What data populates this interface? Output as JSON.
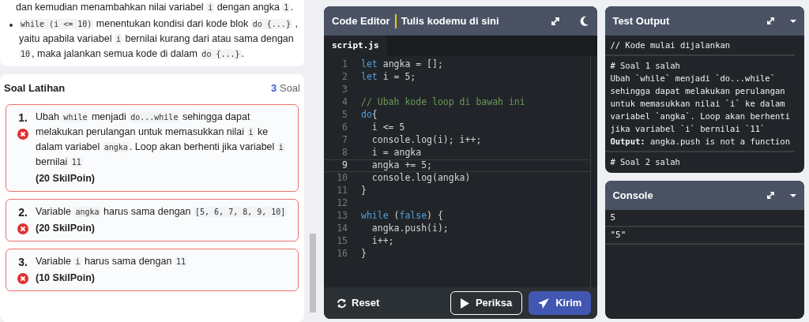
{
  "lesson": {
    "paragraphs": [
      {
        "kind": "paragraph",
        "segments": [
          {
            "kind": "text",
            "text": "dan kemudian menambahkan nilai variabel "
          },
          {
            "kind": "code",
            "text": "i"
          },
          {
            "kind": "text",
            "text": " dengan angka "
          },
          {
            "kind": "code",
            "text": "1"
          },
          {
            "kind": "text",
            "text": "."
          }
        ]
      },
      {
        "kind": "bullet",
        "segments": [
          {
            "kind": "code",
            "text": "while (i <= 10)"
          },
          {
            "kind": "text",
            "text": " menentukan kondisi dari kode blok "
          },
          {
            "kind": "code",
            "text": "do {...}"
          },
          {
            "kind": "text",
            "text": " , yaitu apabila variabel "
          },
          {
            "kind": "code",
            "text": "i"
          },
          {
            "kind": "text",
            "text": " bernilai kurang dari atau sama dengan "
          },
          {
            "kind": "code",
            "text": "10"
          },
          {
            "kind": "text",
            "text": ", maka jalankan semua kode di dalam "
          },
          {
            "kind": "code",
            "text": "do {...}"
          },
          {
            "kind": "text",
            "text": "."
          }
        ]
      }
    ]
  },
  "exercises": {
    "title": "Soal Latihan",
    "count": "3",
    "count_label": "Soal",
    "items": [
      {
        "number": "1.",
        "passed": false,
        "points": "(20 SkilPoin)",
        "segments": [
          {
            "kind": "text",
            "text": "Ubah "
          },
          {
            "kind": "code",
            "text": "while"
          },
          {
            "kind": "text",
            "text": " menjadi "
          },
          {
            "kind": "code",
            "text": "do...while"
          },
          {
            "kind": "text",
            "text": " sehingga dapat melakukan perulangan untuk memasukkan nilai "
          },
          {
            "kind": "code",
            "text": "i"
          },
          {
            "kind": "text",
            "text": " ke dalam variabel "
          },
          {
            "kind": "code",
            "text": "angka"
          },
          {
            "kind": "text",
            "text": ". Loop akan berhenti jika variabel "
          },
          {
            "kind": "code",
            "text": "i"
          },
          {
            "kind": "text",
            "text": " bernilai "
          },
          {
            "kind": "code",
            "text": "11"
          }
        ]
      },
      {
        "number": "2.",
        "passed": false,
        "points": "(20 SkilPoin)",
        "segments": [
          {
            "kind": "text",
            "text": "Variable "
          },
          {
            "kind": "code",
            "text": "angka"
          },
          {
            "kind": "text",
            "text": " harus sama dengan "
          },
          {
            "kind": "code",
            "text": "[5, 6, 7, 8, 9, 10]"
          }
        ]
      },
      {
        "number": "3.",
        "passed": false,
        "points": "(10 SkilPoin)",
        "segments": [
          {
            "kind": "text",
            "text": "Variable "
          },
          {
            "kind": "code",
            "text": "i"
          },
          {
            "kind": "text",
            "text": " harus sama dengan "
          },
          {
            "kind": "code",
            "text": "11"
          }
        ]
      }
    ]
  },
  "editor": {
    "title": "Code Editor",
    "subtitle": "Tulis kodemu di sini",
    "tabs": [
      {
        "label": "script.js",
        "selected": true
      }
    ],
    "lines": [
      {
        "number": "1",
        "selected": false,
        "tokens": [
          {
            "kind": "keyword",
            "text": "let"
          },
          {
            "kind": "plain",
            "text": " angka = [];"
          }
        ]
      },
      {
        "number": "2",
        "selected": false,
        "tokens": [
          {
            "kind": "keyword",
            "text": "let"
          },
          {
            "kind": "plain",
            "text": " i = 5;"
          }
        ]
      },
      {
        "number": "3",
        "selected": false
      },
      {
        "number": "4",
        "selected": false,
        "tokens": [
          {
            "kind": "comment",
            "text": "// Ubah kode loop di bawah ini"
          }
        ]
      },
      {
        "number": "5",
        "selected": false,
        "tokens": [
          {
            "kind": "keyword",
            "text": "do"
          },
          {
            "kind": "plain",
            "text": "{"
          }
        ]
      },
      {
        "number": "6",
        "selected": false,
        "tokens": [
          {
            "kind": "plain",
            "text": "  i <= 5"
          }
        ]
      },
      {
        "number": "7",
        "selected": false,
        "tokens": [
          {
            "kind": "plain",
            "text": "  console.log(i); i++;"
          }
        ]
      },
      {
        "number": "8",
        "selected": false,
        "tokens": [
          {
            "kind": "plain",
            "text": "  i = angka"
          }
        ]
      },
      {
        "number": "9",
        "selected": true,
        "tokens": [
          {
            "kind": "plain",
            "text": "  angka += 5;"
          }
        ]
      },
      {
        "number": "10",
        "selected": false,
        "tokens": [
          {
            "kind": "plain",
            "text": "  console.log(angka)"
          }
        ]
      },
      {
        "number": "11",
        "selected": false,
        "tokens": [
          {
            "kind": "plain",
            "text": "}"
          }
        ]
      },
      {
        "number": "12",
        "selected": false
      },
      {
        "number": "13",
        "selected": false,
        "tokens": [
          {
            "kind": "keyword",
            "text": "while"
          },
          {
            "kind": "plain",
            "text": " ("
          },
          {
            "kind": "keyword",
            "text": "false"
          },
          {
            "kind": "plain",
            "text": ") {"
          }
        ]
      },
      {
        "number": "14",
        "selected": false,
        "tokens": [
          {
            "kind": "plain",
            "text": "  angka.push(i);"
          }
        ]
      },
      {
        "number": "15",
        "selected": false,
        "tokens": [
          {
            "kind": "plain",
            "text": "  i++;"
          }
        ]
      },
      {
        "number": "16",
        "selected": false,
        "tokens": [
          {
            "kind": "plain",
            "text": "}"
          }
        ]
      }
    ],
    "buttons": [
      {
        "kind": "reset",
        "label": "Reset"
      },
      {
        "kind": "check",
        "label": "Periksa"
      },
      {
        "kind": "submit",
        "label": "Kirim"
      }
    ]
  },
  "test_output": {
    "title": "Test Output",
    "entries": [
      {
        "lines": [
          "// Kode mulai dijalankan"
        ]
      },
      {
        "lines": [
          "# Soal 1 salah",
          "Ubah `while` menjadi `do...while`",
          "sehingga dapat melakukan perulangan",
          "untuk memasukkan nilai `i` ke dalam",
          "variabel `angka`. Loop akan berhenti",
          "jika variabel `i` bernilai `11`",
          "**Output:** angka.push is not a function"
        ]
      },
      {
        "lines": [
          "# Soal 2 salah"
        ]
      }
    ]
  },
  "console": {
    "title": "Console",
    "entries": [
      "5",
      "\"5\""
    ]
  }
}
